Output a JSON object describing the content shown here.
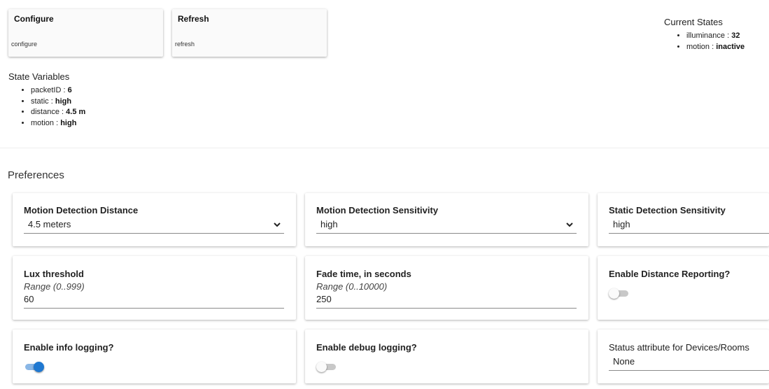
{
  "commands": [
    {
      "title": "Configure",
      "param": "configure"
    },
    {
      "title": "Refresh",
      "param": "refresh"
    }
  ],
  "current_states": {
    "title": "Current States",
    "items": [
      {
        "key": "illuminance",
        "sep": " : ",
        "value": "32"
      },
      {
        "key": "motion",
        "sep": " : ",
        "value": "inactive"
      }
    ]
  },
  "state_variables": {
    "title": "State Variables",
    "items": [
      {
        "key": "packetID",
        "sep": " : ",
        "value": "6"
      },
      {
        "key": "static",
        "sep": " : ",
        "value": "high"
      },
      {
        "key": "distance",
        "sep": " : ",
        "value": "4.5 m"
      },
      {
        "key": "motion",
        "sep": " : ",
        "value": "high"
      }
    ]
  },
  "preferences": {
    "title": "Preferences",
    "motion_distance": {
      "label": "Motion Detection Distance",
      "value": "4.5 meters"
    },
    "motion_sensitivity": {
      "label": "Motion Detection Sensitivity",
      "value": "high"
    },
    "static_sensitivity": {
      "label": "Static Detection Sensitivity",
      "value": "high"
    },
    "lux_threshold": {
      "label": "Lux threshold",
      "range": "Range (0..999)",
      "value": "60"
    },
    "fade_time": {
      "label": "Fade time, in seconds",
      "range": "Range (0..10000)",
      "value": "250"
    },
    "distance_reporting": {
      "label": "Enable Distance Reporting?",
      "enabled": false
    },
    "info_logging": {
      "label": "Enable info logging?",
      "enabled": true
    },
    "debug_logging": {
      "label": "Enable debug logging?",
      "enabled": false
    },
    "status_attribute": {
      "label": "Status attribute for Devices/Rooms",
      "value": "None"
    }
  },
  "colors": {
    "accent": "#1f78d1",
    "accent_track": "#8ab7e6"
  }
}
